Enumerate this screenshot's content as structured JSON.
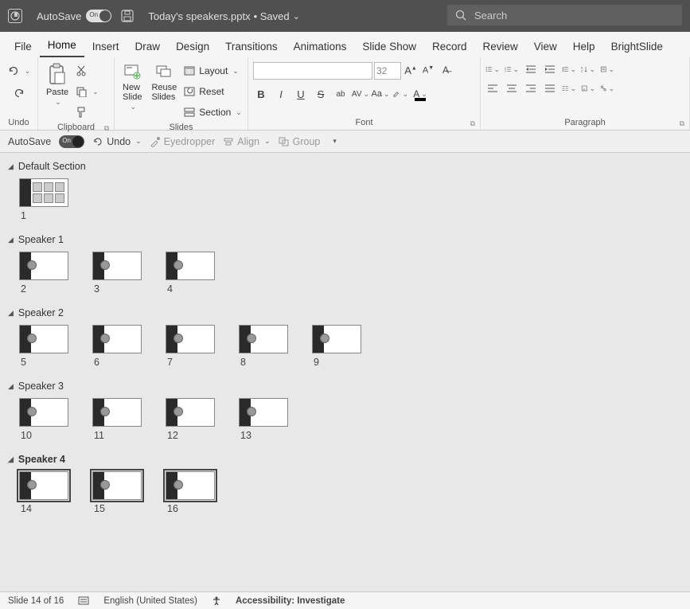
{
  "titlebar": {
    "autosave_label": "AutoSave",
    "autosave_on": "On",
    "doc_title": "Today's speakers.pptx",
    "saved_marker": "• Saved",
    "search_placeholder": "Search"
  },
  "tabs": [
    "File",
    "Home",
    "Insert",
    "Draw",
    "Design",
    "Transitions",
    "Animations",
    "Slide Show",
    "Record",
    "Review",
    "View",
    "Help",
    "BrightSlide"
  ],
  "tabs_active_index": 1,
  "ribbon": {
    "undo_group_label": "Undo",
    "clipboard": {
      "paste": "Paste",
      "label": "Clipboard"
    },
    "slides": {
      "new_slide": "New\nSlide",
      "reuse": "Reuse\nSlides",
      "layout": "Layout",
      "reset": "Reset",
      "section": "Section",
      "label": "Slides"
    },
    "font": {
      "label": "Font",
      "size": "32"
    },
    "paragraph": {
      "label": "Paragraph"
    }
  },
  "qat": {
    "autosave_label": "AutoSave",
    "autosave_on": "On",
    "undo": "Undo",
    "eyedropper": "Eyedropper",
    "align": "Align",
    "group": "Group"
  },
  "sections": [
    {
      "name": "Default Section",
      "bold": false,
      "slides": [
        1
      ]
    },
    {
      "name": "Speaker 1",
      "bold": false,
      "slides": [
        2,
        3,
        4
      ]
    },
    {
      "name": "Speaker 2",
      "bold": false,
      "slides": [
        5,
        6,
        7,
        8,
        9
      ]
    },
    {
      "name": "Speaker 3",
      "bold": false,
      "slides": [
        10,
        11,
        12,
        13
      ]
    },
    {
      "name": "Speaker 4",
      "bold": true,
      "slides": [
        14,
        15,
        16
      ]
    }
  ],
  "selected_section_index": 4,
  "statusbar": {
    "slide_pos": "Slide 14 of 16",
    "lang": "English (United States)",
    "acc": "Accessibility: Investigate"
  }
}
